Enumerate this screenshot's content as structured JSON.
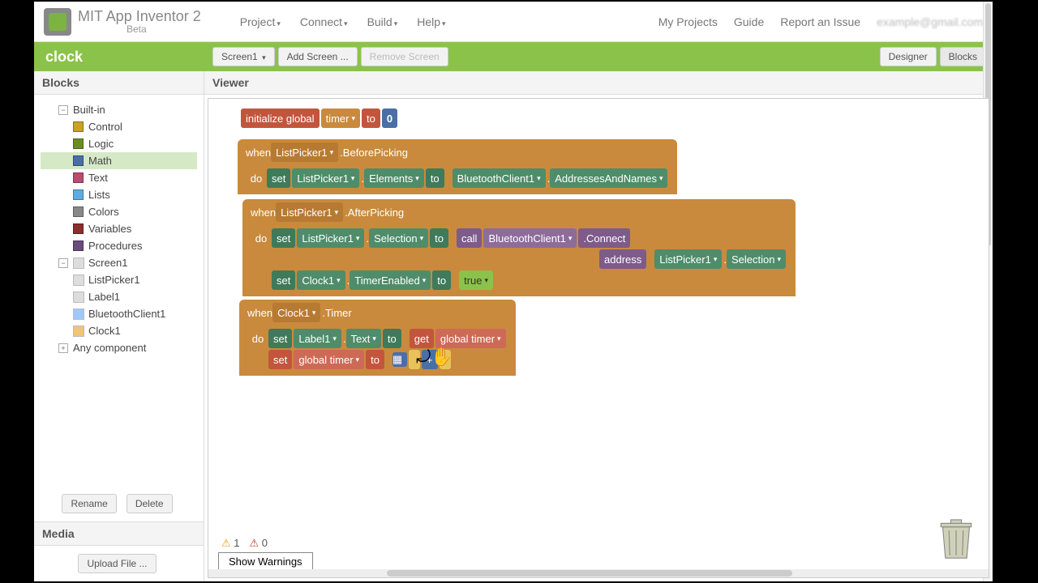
{
  "header": {
    "title": "MIT App Inventor 2",
    "subtitle": "Beta",
    "menus": [
      "Project",
      "Connect",
      "Build",
      "Help"
    ],
    "right": {
      "my_projects": "My Projects",
      "guide": "Guide",
      "report": "Report an Issue",
      "user": "example@gmail.com"
    }
  },
  "toolbar": {
    "project": "clock",
    "screen_btn": "Screen1",
    "add_screen": "Add Screen ...",
    "remove_screen": "Remove Screen",
    "designer": "Designer",
    "blocks": "Blocks"
  },
  "panels": {
    "blocks": "Blocks",
    "viewer": "Viewer",
    "media": "Media"
  },
  "tree": {
    "builtin": "Built-in",
    "items": [
      "Control",
      "Logic",
      "Math",
      "Text",
      "Lists",
      "Colors",
      "Variables",
      "Procedures"
    ],
    "screen": "Screen1",
    "components": [
      "ListPicker1",
      "Label1",
      "BluetoothClient1",
      "Clock1"
    ],
    "any": "Any component",
    "rename": "Rename",
    "delete": "Delete"
  },
  "media": {
    "upload": "Upload File ..."
  },
  "workspace": {
    "init": {
      "a": "initialize global",
      "b": "timer",
      "c": "to",
      "d": "0"
    },
    "ev1": {
      "when": "when",
      "comp": "ListPicker1",
      "evt": ".BeforePicking",
      "do": "do",
      "set": "set",
      "c1": "ListPicker1",
      "p1": "Elements",
      "to": "to",
      "c2": "BluetoothClient1",
      "p2": "AddressesAndNames"
    },
    "ev2": {
      "when": "when",
      "comp": "ListPicker1",
      "evt": ".AfterPicking",
      "do": "do",
      "set": "set",
      "c1": "ListPicker1",
      "p1": "Selection",
      "to": "to",
      "call": "call",
      "c2": "BluetoothClient1",
      "m": ".Connect",
      "addr": "address",
      "c3": "ListPicker1",
      "p3": "Selection",
      "set2": "set",
      "c4": "Clock1",
      "p4": "TimerEnabled",
      "to2": "to",
      "true": "true"
    },
    "ev3": {
      "when": "when",
      "comp": "Clock1",
      "evt": ".Timer",
      "do": "do",
      "set": "set",
      "c1": "Label1",
      "p1": "Text",
      "to": "to",
      "get": "get",
      "gv": "global timer",
      "set2": "set",
      "gv2": "global timer",
      "to2": "to",
      "plus": "+"
    },
    "status": {
      "warn": "1",
      "err": "0",
      "show": "Show Warnings"
    }
  }
}
